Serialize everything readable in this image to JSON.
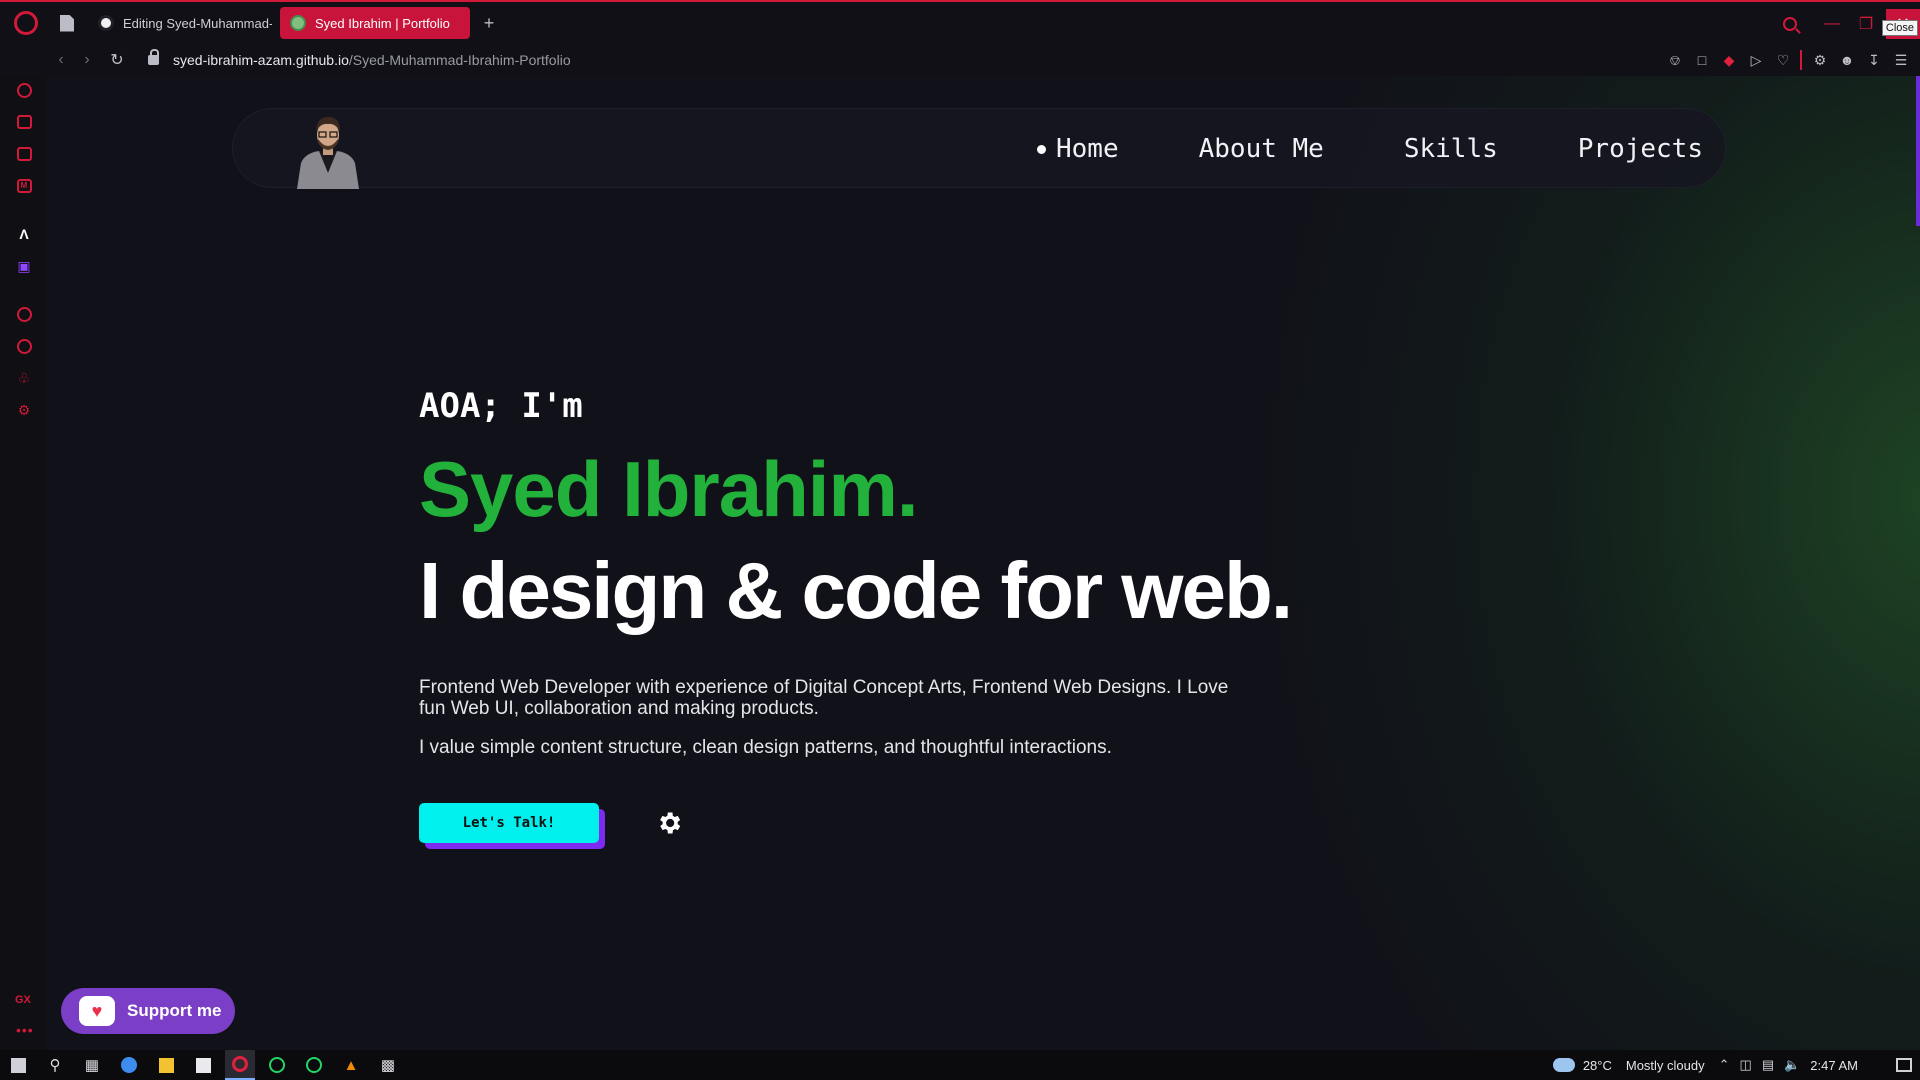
{
  "browser": {
    "tabs": [
      {
        "label": "Editing Syed-Muhammad-Ibrahim-Portfolio",
        "active": false,
        "favicon": "github-icon"
      },
      {
        "label": "Syed Ibrahim | Portfolio",
        "active": true,
        "favicon": "portfolio-favicon"
      }
    ],
    "url_host": "syed-ibrahim-azam.github.io",
    "url_path": "/Syed-Muhammad-Ibrahim-Portfolio",
    "close_tooltip": "Close",
    "accent_color": "#d11a3a"
  },
  "navbar": {
    "links": [
      {
        "label": "Home",
        "active": true
      },
      {
        "label": "About Me",
        "active": false
      },
      {
        "label": "Skills",
        "active": false
      },
      {
        "label": "Projects",
        "active": false
      }
    ]
  },
  "hero": {
    "greeting": "AOA; I'm",
    "name": "Syed Ibrahim.",
    "tagline": "I design & code for web.",
    "description": "Frontend Web Developer with experience of Digital Concept Arts, Frontend Web Designs. I Love fun Web UI, collaboration and making products.",
    "description2": "I value simple content structure, clean design patterns, and thoughtful interactions.",
    "cta_label": "Let's Talk!",
    "name_color": "#22b13b",
    "cta_color": "#00f0ee",
    "cta_shadow_color": "#7d2bf0"
  },
  "support": {
    "label": "Support me"
  },
  "sidebar": {
    "gx_label": "GX"
  },
  "taskbar": {
    "weather_temp": "28°C",
    "weather_desc": "Mostly cloudy",
    "time": "2:47 AM"
  }
}
